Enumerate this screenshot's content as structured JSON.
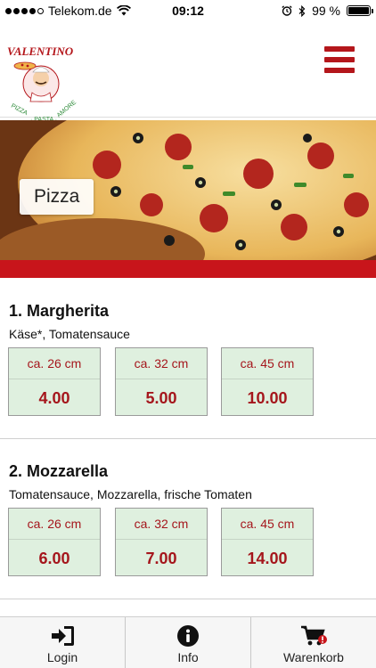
{
  "status_bar": {
    "carrier": "Telekom.de",
    "time": "09:12",
    "battery": "99 %",
    "battery_level": 0.99
  },
  "header": {
    "logo_text": "VALENTINO",
    "logo_tagline": "PIZZA · PASTA · AMORE",
    "menu_icon": "hamburger-icon"
  },
  "hero": {
    "category_label": "Pizza"
  },
  "colors": {
    "brand_red": "#c8151b",
    "price_red": "#a5161c",
    "size_box_bg": "#dff0df"
  },
  "menu": {
    "items": [
      {
        "title": "1. Margherita",
        "description": "Käse*, Tomatensauce",
        "sizes": [
          {
            "size": "ca. 26 cm",
            "price": "4.00"
          },
          {
            "size": "ca. 32 cm",
            "price": "5.00"
          },
          {
            "size": "ca. 45 cm",
            "price": "10.00"
          }
        ]
      },
      {
        "title": "2. Mozzarella",
        "description": "Tomatensauce, Mozzarella, frische Tomaten",
        "sizes": [
          {
            "size": "ca. 26 cm",
            "price": "6.00"
          },
          {
            "size": "ca. 32 cm",
            "price": "7.00"
          },
          {
            "size": "ca. 45 cm",
            "price": "14.00"
          }
        ]
      }
    ]
  },
  "tabbar": {
    "tabs": [
      {
        "label": "Login",
        "icon": "login-icon"
      },
      {
        "label": "Info",
        "icon": "info-icon"
      },
      {
        "label": "Warenkorb",
        "icon": "cart-icon"
      }
    ]
  }
}
